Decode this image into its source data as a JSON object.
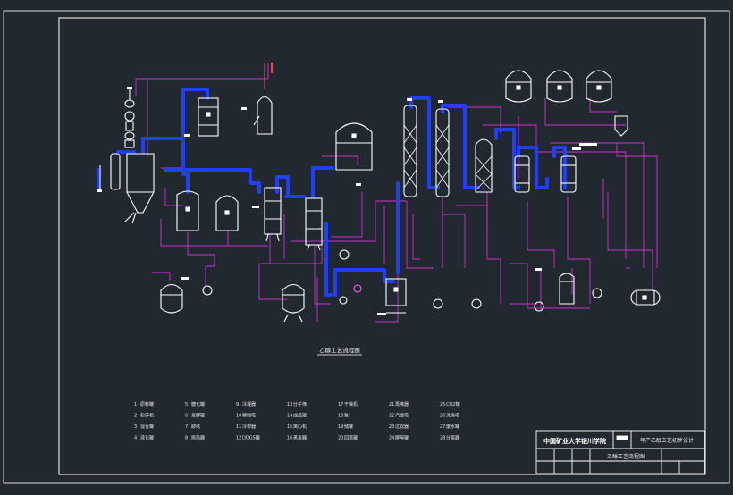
{
  "diagram": {
    "title": "乙醇工艺流程图",
    "legend": [
      [
        "1",
        "原料罐"
      ],
      [
        "2",
        "粉碎机"
      ],
      [
        "3",
        "混合罐"
      ],
      [
        "4",
        "液化罐"
      ],
      [
        "5",
        "糖化罐"
      ],
      [
        "6",
        "发酵罐"
      ],
      [
        "7",
        "醪塔"
      ],
      [
        "8",
        "换热器"
      ],
      [
        "9",
        "冷凝器"
      ],
      [
        "10",
        "精馏塔"
      ],
      [
        "11",
        "冷却器"
      ],
      [
        "12",
        "DDGS罐"
      ],
      [
        "13",
        "分子筛"
      ],
      [
        "14",
        "成品罐"
      ],
      [
        "15",
        "离心机"
      ],
      [
        "16",
        "蒸发器"
      ],
      [
        "17",
        "干燥机"
      ],
      [
        "18",
        "泵"
      ],
      [
        "19",
        "储罐"
      ],
      [
        "20",
        "回流罐"
      ],
      [
        "21",
        "再沸器"
      ],
      [
        "22",
        "汽提塔"
      ],
      [
        "23",
        "过滤器"
      ],
      [
        "24",
        "酵母罐"
      ],
      [
        "25",
        "CO2罐"
      ],
      [
        "26",
        "洗涤塔"
      ],
      [
        "27",
        "废水罐"
      ],
      [
        "28",
        "分离器"
      ]
    ]
  },
  "title_block": {
    "school": "中国矿业大学银川学院",
    "project": "年产乙醇工艺初步设计",
    "drawing_name": "乙醇工艺流程图"
  }
}
